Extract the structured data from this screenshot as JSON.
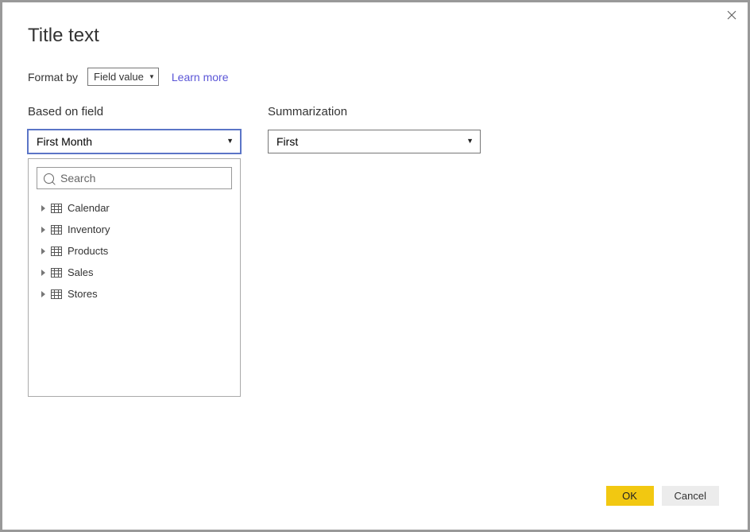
{
  "dialog": {
    "title": "Title text",
    "format_by_label": "Format by",
    "format_by_value": "Field value",
    "learn_more": "Learn more",
    "based_on_field": {
      "label": "Based on field",
      "value": "First Month",
      "search_placeholder": "Search",
      "tables": [
        "Calendar",
        "Inventory",
        "Products",
        "Sales",
        "Stores"
      ]
    },
    "summarization": {
      "label": "Summarization",
      "value": "First"
    },
    "buttons": {
      "ok": "OK",
      "cancel": "Cancel"
    }
  }
}
